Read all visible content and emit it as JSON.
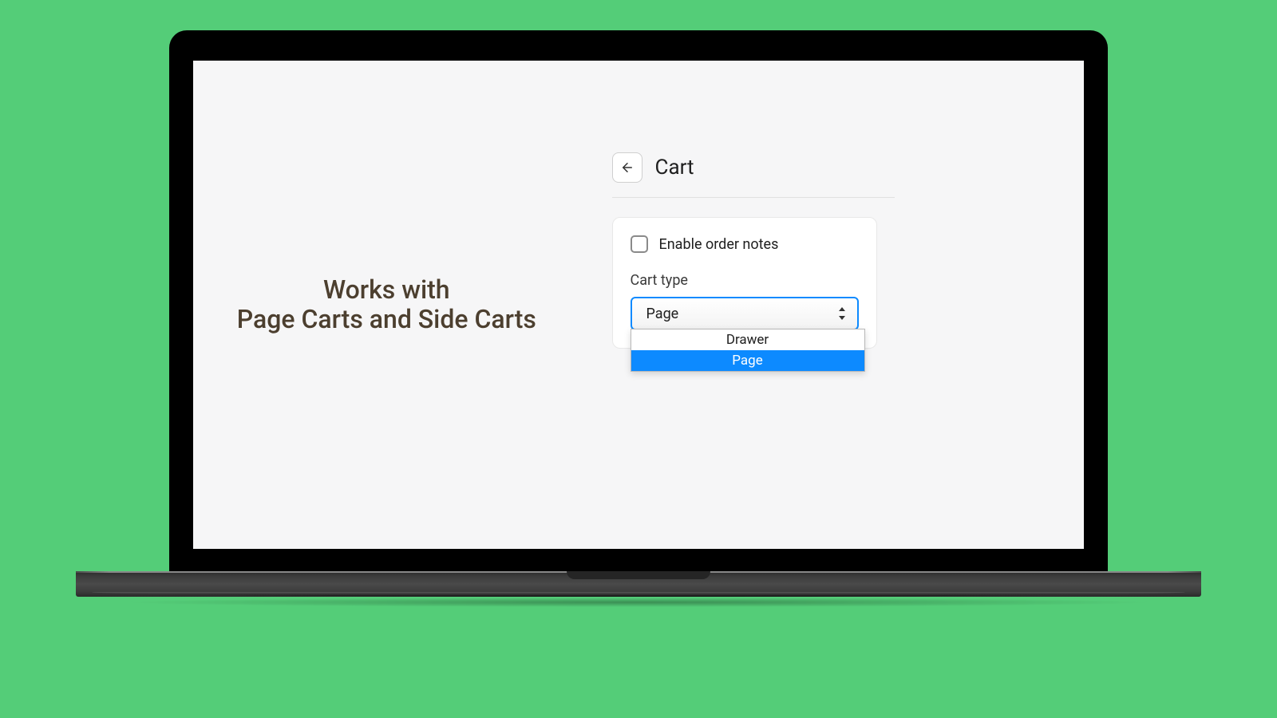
{
  "marketing": {
    "line1": "Works with",
    "line2": "Page Carts and Side Carts"
  },
  "panel": {
    "title": "Cart",
    "enable_notes_label": "Enable order notes",
    "cart_type_label": "Cart type",
    "cart_type_selected": "Page",
    "dropdown": {
      "option1": "Drawer",
      "option2": "Page"
    }
  }
}
